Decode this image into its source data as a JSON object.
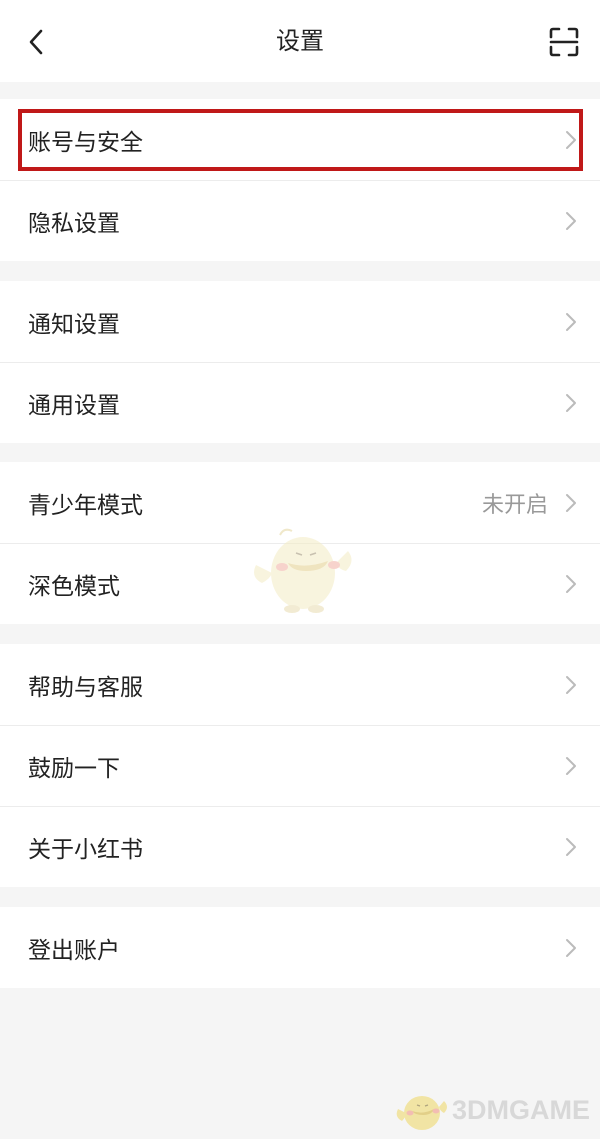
{
  "header": {
    "title": "设置"
  },
  "groups": [
    {
      "items": [
        {
          "label": "账号与安全"
        },
        {
          "label": "隐私设置"
        }
      ]
    },
    {
      "items": [
        {
          "label": "通知设置"
        },
        {
          "label": "通用设置"
        }
      ]
    },
    {
      "items": [
        {
          "label": "青少年模式",
          "value": "未开启"
        },
        {
          "label": "深色模式"
        }
      ]
    },
    {
      "items": [
        {
          "label": "帮助与客服"
        },
        {
          "label": "鼓励一下"
        },
        {
          "label": "关于小红书"
        }
      ]
    },
    {
      "items": [
        {
          "label": "登出账户"
        }
      ]
    }
  ],
  "watermark": {
    "text": "3DMGAME"
  },
  "colors": {
    "highlight_border": "#c01818",
    "background": "#f5f5f5",
    "chevron": "#bbbbbb"
  }
}
